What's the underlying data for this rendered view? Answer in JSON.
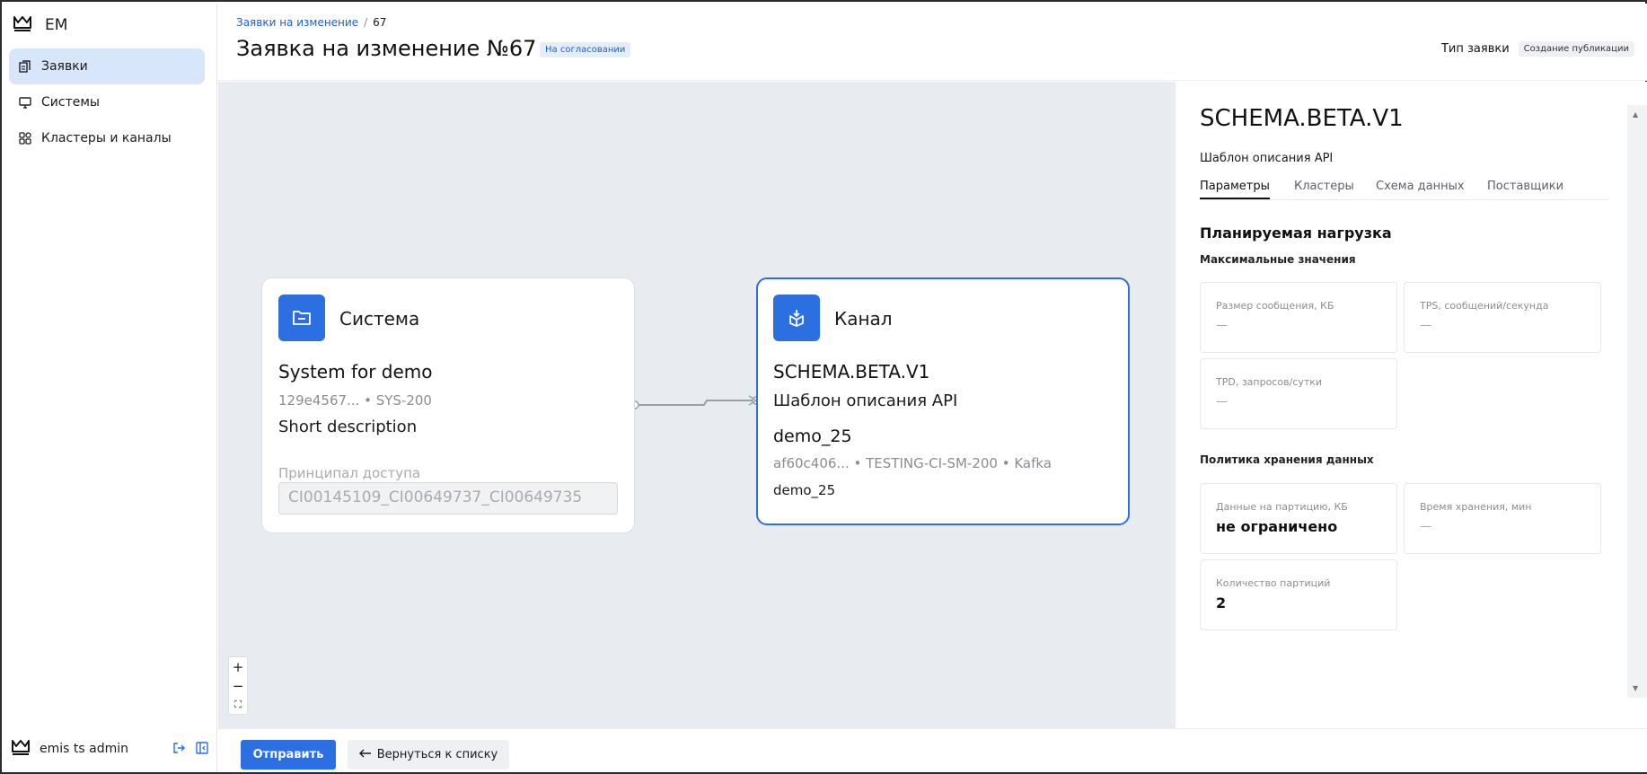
{
  "app": {
    "logo_text": "EM"
  },
  "sidebar": {
    "items": [
      {
        "label": "Заявки",
        "icon": "documents-icon",
        "active": true
      },
      {
        "label": "Системы",
        "icon": "monitor-icon",
        "active": false
      },
      {
        "label": "Кластеры и каналы",
        "icon": "grid-icon",
        "active": false
      }
    ],
    "user": {
      "name": "emis ts admin"
    }
  },
  "header": {
    "breadcrumb": {
      "parent": "Заявки на изменение",
      "separator": "/",
      "current": "67"
    },
    "title": "Заявка на изменение №67",
    "status": "На согласовании",
    "request_type_label": "Тип заявки",
    "request_type_value": "Создание публикации"
  },
  "canvas": {
    "system_node": {
      "kind": "Система",
      "name": "System for demo",
      "meta": "129e4567... • SYS-200",
      "description": "Short description",
      "principal_label": "Принципал доступа",
      "principal_value": "CI00145109_CI00649737_CI00649735"
    },
    "channel_node": {
      "kind": "Канал",
      "name": "SCHEMA.BETA.V1",
      "description": "Шаблон описания API",
      "topic": "demo_25",
      "meta": "af60c406... • TESTING-CI-SM-200 • Kafka",
      "subtitle": "demo_25"
    },
    "zoom": {
      "in": "+",
      "out": "−",
      "fit": "⛶"
    }
  },
  "panel": {
    "title": "SCHEMA.BETA.V1",
    "subtitle": "Шаблон описания API",
    "tabs": [
      {
        "label": "Параметры",
        "active": true
      },
      {
        "label": "Кластеры",
        "active": false
      },
      {
        "label": "Схема данных",
        "active": false
      },
      {
        "label": "Поставщики",
        "active": false
      }
    ],
    "load_heading": "Планируемая нагрузка",
    "max_heading": "Максимальные значения",
    "max_cards": [
      {
        "label": "Размер сообщения, КБ",
        "value": "—"
      },
      {
        "label": "TPS, сообщений/секунда",
        "value": "—"
      },
      {
        "label": "TPD, запросов/сутки",
        "value": "—"
      }
    ],
    "retention_heading": "Политика хранения данных",
    "retention_cards": [
      {
        "label": "Данные на партицию, КБ",
        "value": "не ограничено"
      },
      {
        "label": "Время хранения, мин",
        "value": "—"
      },
      {
        "label": "Количество партиций",
        "value": "2"
      }
    ]
  },
  "footer": {
    "submit_label": "Отправить",
    "back_label": "Вернуться к списку"
  },
  "colors": {
    "accent": "#2b6fe0",
    "active_nav": "#d8e6fb",
    "canvas_bg": "#e8ecf1"
  }
}
